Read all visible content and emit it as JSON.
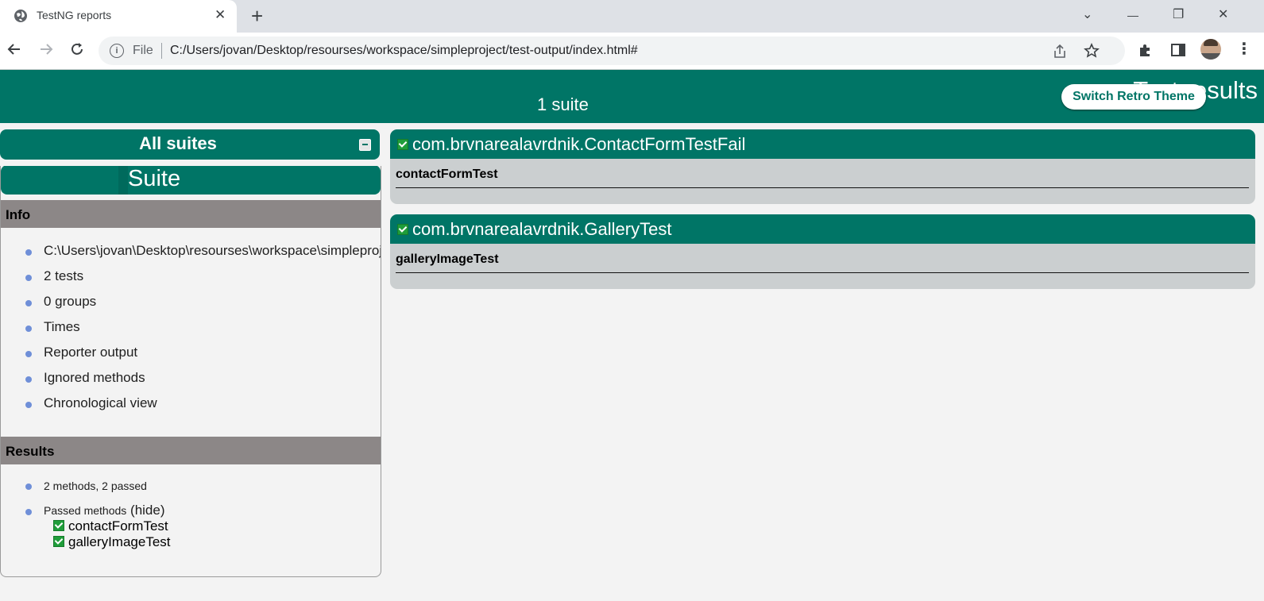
{
  "browser": {
    "tab_title": "TestNG reports",
    "tab_close": "✕",
    "new_tab": "+",
    "omnibox_scheme_label": "File",
    "url": "C:/Users/jovan/Desktop/resourses/workspace/simpleproject/test-output/index.html#",
    "window_controls": {
      "list": "⌄",
      "minimize": "—",
      "restore": "❐",
      "close": "✕"
    },
    "icons": [
      "globe-icon",
      "back-icon",
      "forward-icon",
      "reload-icon",
      "info-icon",
      "share-icon",
      "star-icon",
      "extensions-icon",
      "sidepanel-icon",
      "profile-avatar",
      "menu-icon"
    ]
  },
  "header": {
    "title": "Test results",
    "suite_count": "1 suite",
    "theme_button": "Switch Retro Theme"
  },
  "sidebar": {
    "all_suites_label": "All suites",
    "suite_name": "Suite",
    "info": {
      "label": "Info",
      "items": [
        "C:\\Users\\jovan\\Desktop\\resourses\\workspace\\simpleproject\\testng.xml",
        "2 tests",
        "0 groups",
        "Times",
        "Reporter output",
        "Ignored methods",
        "Chronological view"
      ]
    },
    "results": {
      "label": "Results",
      "summary": "2 methods, 2 passed",
      "passed_label": "Passed methods",
      "hide_label": "(hide)",
      "methods": [
        "contactFormTest",
        "galleryImageTest"
      ]
    }
  },
  "main": {
    "classes": [
      {
        "name": "com.brvnarealavrdnik.ContactFormTestFail",
        "method": "contactFormTest"
      },
      {
        "name": "com.brvnarealavrdnik.GalleryTest",
        "method": "galleryImageTest"
      }
    ]
  },
  "colors": {
    "accent": "#007566",
    "section_bar": "#8c8787",
    "card_bg": "#cbcfd0",
    "page_bg": "#f3f3f3",
    "pass_check": "#1f9d3a"
  }
}
